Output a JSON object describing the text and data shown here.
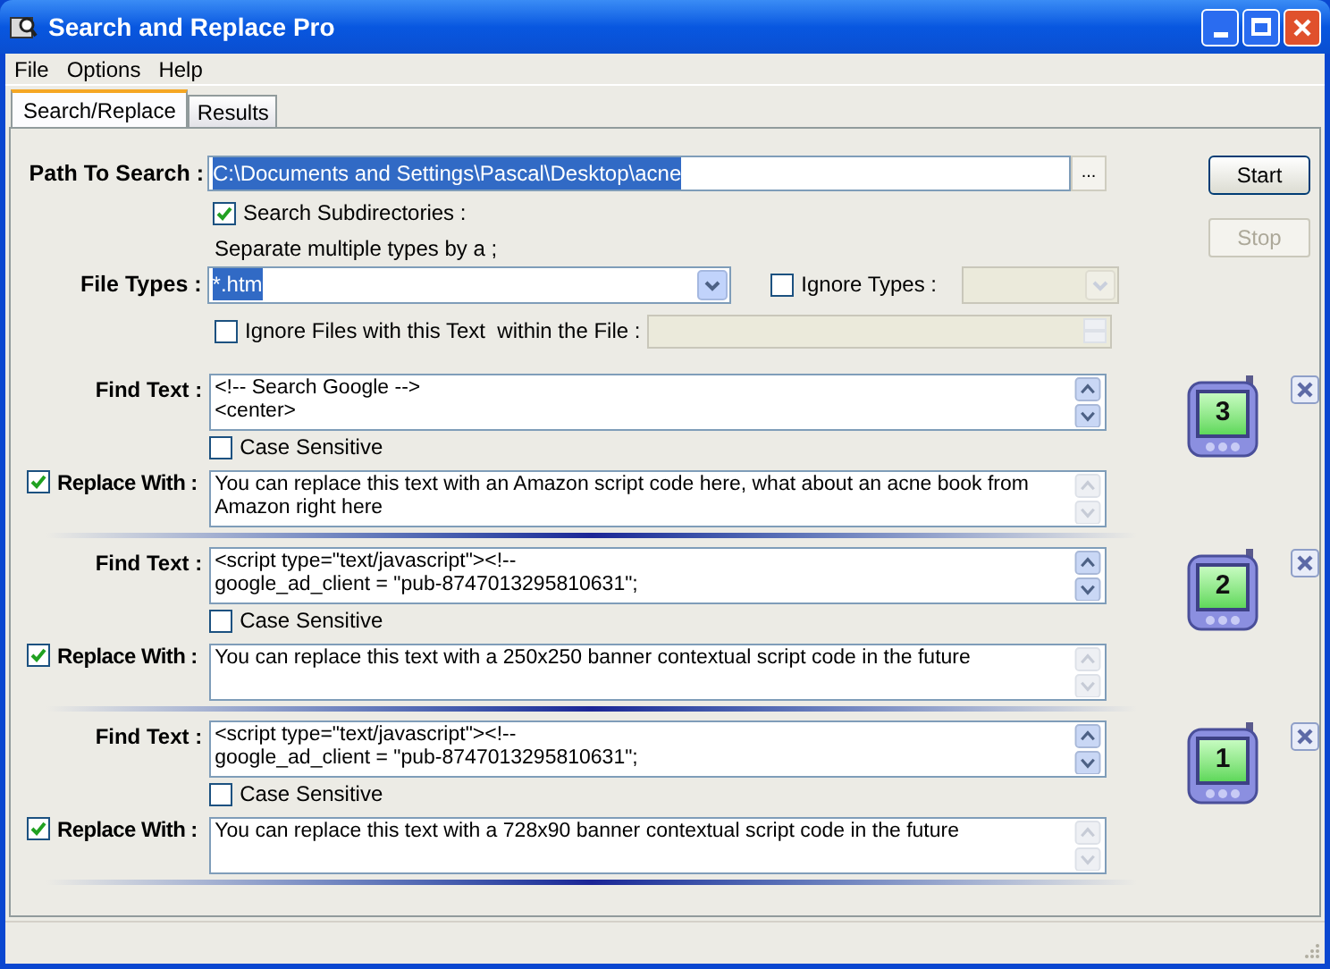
{
  "window": {
    "title": "Search and Replace Pro"
  },
  "menu": [
    "File",
    "Options",
    "Help"
  ],
  "tabs": [
    {
      "label": "Search/Replace",
      "selected": true
    },
    {
      "label": "Results",
      "selected": false
    }
  ],
  "path": {
    "label": "Path To Search :",
    "value": "C:\\Documents and Settings\\Pascal\\Desktop\\acne",
    "browse": "..."
  },
  "search_subdirectories": {
    "label": "Search Subdirectories :",
    "checked": true
  },
  "hint": "Separate multiple types by a ;",
  "file_types": {
    "label": "File Types :",
    "value": "*.htm"
  },
  "ignore_types": {
    "label": "Ignore Types :",
    "checked": false
  },
  "ignore_files": {
    "label": "Ignore Files with this Text  within the File :",
    "checked": false
  },
  "buttons": [
    {
      "label": "Start",
      "disabled": false
    },
    {
      "label": "Stop",
      "disabled": true
    }
  ],
  "rules": [
    {
      "number": "3",
      "find_label": "Find Text :",
      "find_lines": [
        "<!-- Search Google -->",
        "<center>"
      ],
      "case_sensitive": {
        "label": "Case Sensitive",
        "checked": false
      },
      "replace_enabled": true,
      "replace_label": "Replace With :",
      "replace_text": "You can replace this text with an Amazon script code here, what about an acne book from Amazon right here"
    },
    {
      "number": "2",
      "find_label": "Find Text :",
      "find_lines": [
        "<script type=\"text/javascript\"><!--",
        "google_ad_client = \"pub-8747013295810631\";"
      ],
      "case_sensitive": {
        "label": "Case Sensitive",
        "checked": false
      },
      "replace_enabled": true,
      "replace_label": "Replace With :",
      "replace_text": "You can replace this text with a 250x250 banner contextual script code in the future"
    },
    {
      "number": "1",
      "find_label": "Find Text :",
      "find_lines": [
        "<script type=\"text/javascript\"><!--",
        "google_ad_client = \"pub-8747013295810631\";"
      ],
      "case_sensitive": {
        "label": "Case Sensitive",
        "checked": false
      },
      "replace_enabled": true,
      "replace_label": "Replace With :",
      "replace_text": "You can replace this text with a 728x90 banner contextual script code in the future"
    }
  ]
}
